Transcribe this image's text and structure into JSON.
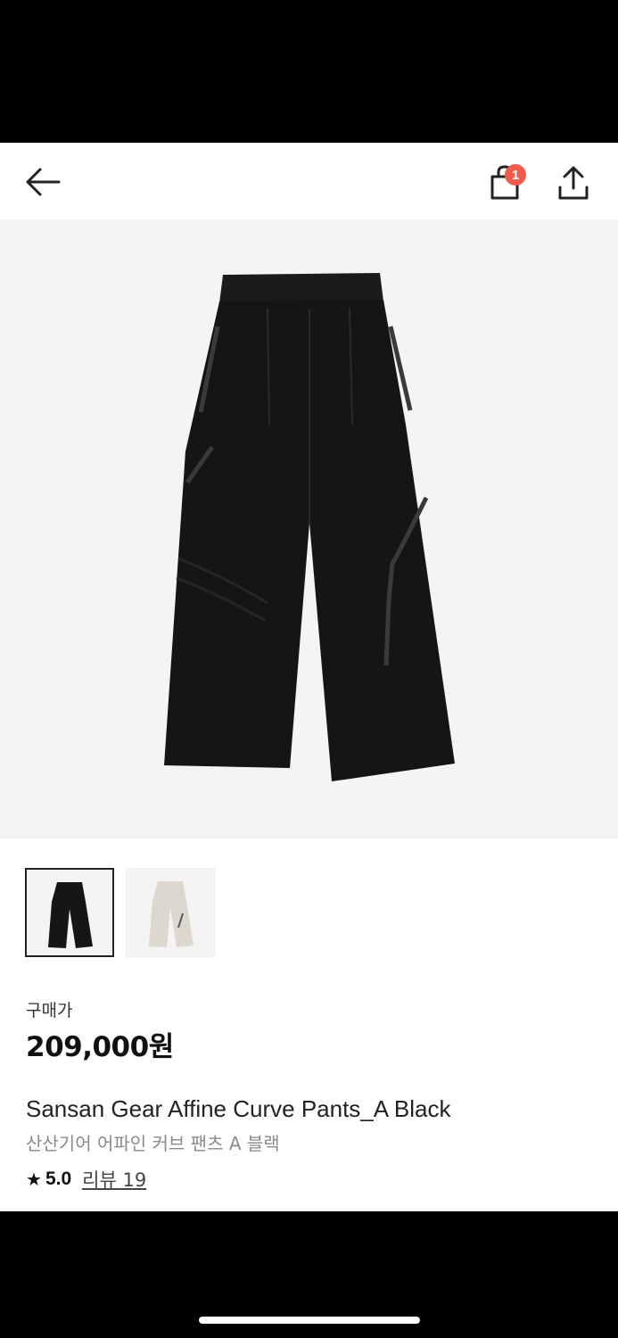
{
  "header": {
    "back_icon": "arrow-left-icon",
    "cart_icon": "shopping-bag-icon",
    "cart_badge": "1",
    "share_icon": "share-upload-icon",
    "badge_color": "#ef5b4c"
  },
  "product": {
    "price_label": "구매가",
    "price": "209,000원",
    "name_en": "Sansan Gear Affine Curve Pants_A Black",
    "name_ko": "산산기어 어파인 커브 팬츠 A 블랙",
    "rating": "5.0",
    "review_label": "리뷰 19"
  },
  "thumbnails": [
    {
      "color": "black",
      "selected": true
    },
    {
      "color": "light-beige",
      "selected": false
    }
  ]
}
